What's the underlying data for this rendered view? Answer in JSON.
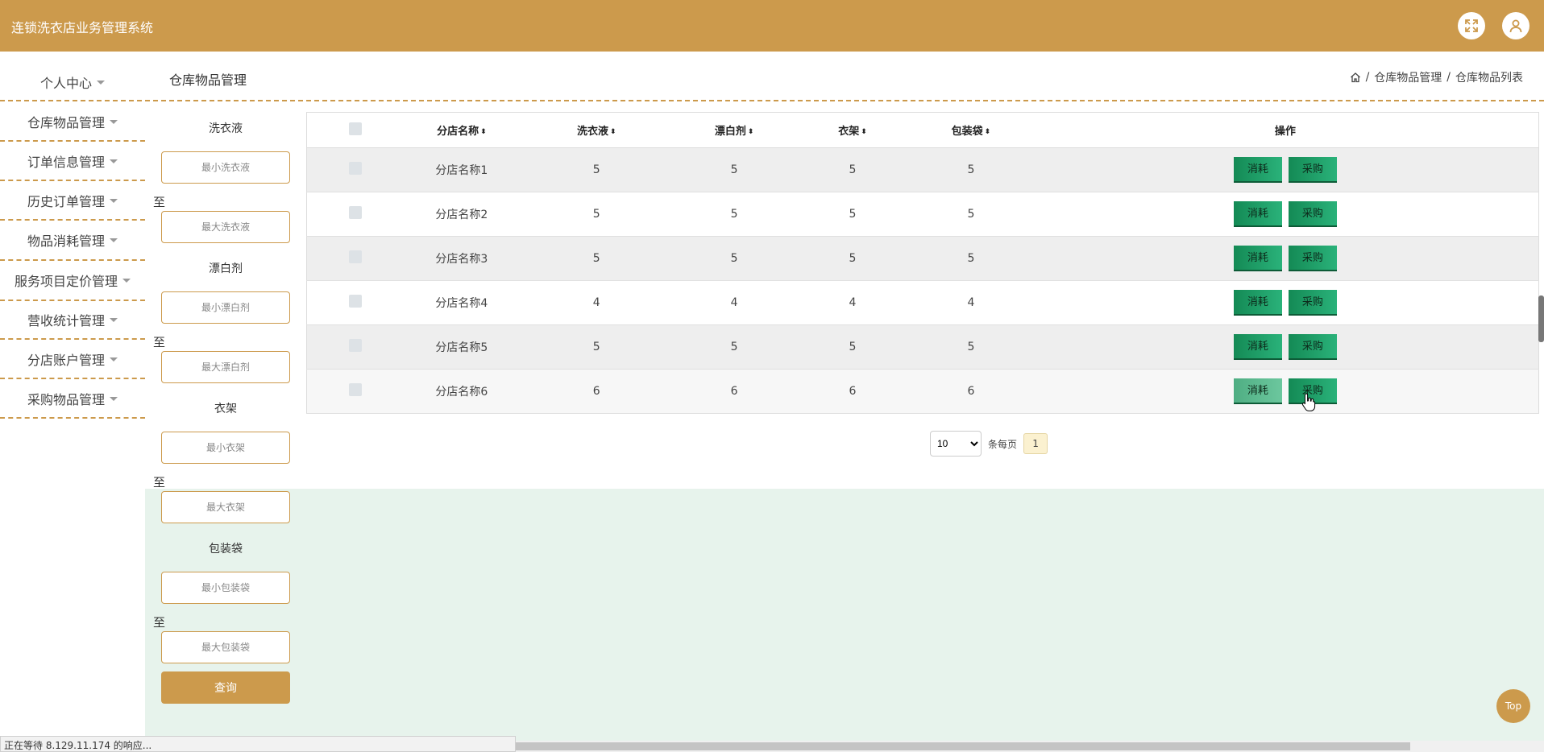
{
  "app": {
    "title": "连锁洗衣店业务管理系统"
  },
  "header_icons": [
    "fullscreen-icon",
    "user-icon"
  ],
  "sidebar": {
    "items": [
      {
        "label": "个人中心"
      },
      {
        "label": "仓库物品管理"
      },
      {
        "label": "订单信息管理"
      },
      {
        "label": "历史订单管理"
      },
      {
        "label": "物品消耗管理"
      },
      {
        "label": "服务项目定价管理"
      },
      {
        "label": "营收统计管理"
      },
      {
        "label": "分店账户管理"
      },
      {
        "label": "采购物品管理"
      }
    ]
  },
  "page": {
    "title": "仓库物品管理"
  },
  "breadcrumb": {
    "home_icon": "home-icon",
    "level1": "仓库物品管理",
    "sep": "/",
    "level2": "仓库物品列表"
  },
  "filters": {
    "to_label": "至",
    "groups": [
      {
        "label": "洗衣液",
        "min_placeholder": "最小洗衣液",
        "max_placeholder": "最大洗衣液"
      },
      {
        "label": "漂白剂",
        "min_placeholder": "最小漂白剂",
        "max_placeholder": "最大漂白剂"
      },
      {
        "label": "衣架",
        "min_placeholder": "最小衣架",
        "max_placeholder": "最大衣架"
      },
      {
        "label": "包装袋",
        "min_placeholder": "最小包装袋",
        "max_placeholder": "最大包装袋"
      }
    ],
    "query_label": "查询"
  },
  "table": {
    "columns": [
      "分店名称",
      "洗衣液",
      "漂白剂",
      "衣架",
      "包装袋",
      "操作"
    ],
    "sort_icon": "⬍",
    "rows": [
      {
        "name": "分店名称1",
        "detergent": "5",
        "bleach": "5",
        "hanger": "5",
        "bag": "5"
      },
      {
        "name": "分店名称2",
        "detergent": "5",
        "bleach": "5",
        "hanger": "5",
        "bag": "5"
      },
      {
        "name": "分店名称3",
        "detergent": "5",
        "bleach": "5",
        "hanger": "5",
        "bag": "5"
      },
      {
        "name": "分店名称4",
        "detergent": "4",
        "bleach": "4",
        "hanger": "4",
        "bag": "4"
      },
      {
        "name": "分店名称5",
        "detergent": "5",
        "bleach": "5",
        "hanger": "5",
        "bag": "5"
      },
      {
        "name": "分店名称6",
        "detergent": "6",
        "bleach": "6",
        "hanger": "6",
        "bag": "6"
      }
    ],
    "actions": {
      "consume": "消耗",
      "purchase": "采购"
    }
  },
  "pagination": {
    "page_size": "10",
    "page_size_options": [
      "10"
    ],
    "per_page_label": "条每页",
    "current_page": "1"
  },
  "top_button": "Top",
  "status_bar": "正在等待 8.129.11.174 的响应...",
  "colors": {
    "accent": "#cc9a4c",
    "action_green": "#148a55",
    "content_bg": "#e7f3ec"
  }
}
